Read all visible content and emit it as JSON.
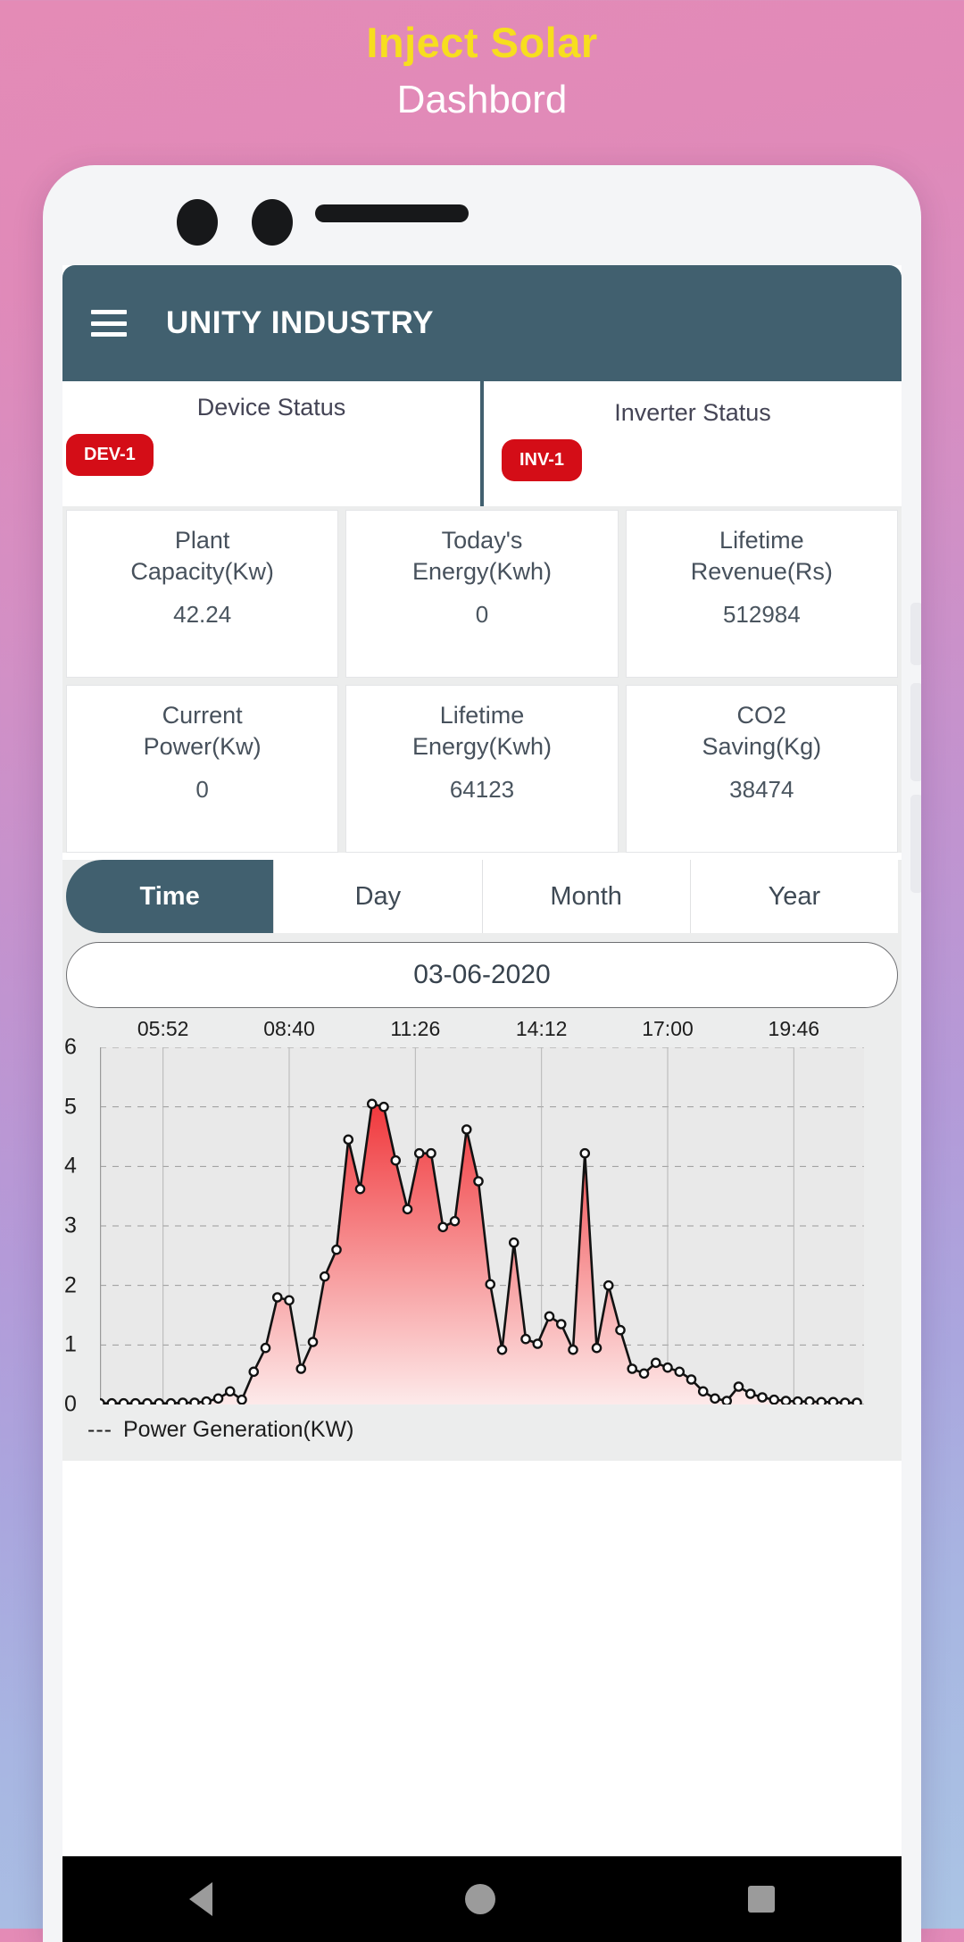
{
  "promo": {
    "title": "Inject Solar",
    "subtitle": "Dashbord",
    "title_color": "#f7de1e",
    "subtitle_color": "#ffffff"
  },
  "appbar": {
    "menu_icon": "hamburger-menu-icon",
    "title": "UNITY INDUSTRY",
    "background": "#41606f"
  },
  "status": {
    "device": {
      "label": "Device Status",
      "badge": "DEV-1",
      "badge_color": "#d40d17"
    },
    "inverter": {
      "label": "Inverter Status",
      "badge": "INV-1",
      "badge_color": "#d40d17"
    }
  },
  "cards": [
    {
      "label": "Plant\nCapacity(Kw)",
      "line1": "Plant",
      "line2": "Capacity(Kw)",
      "value": "42.24"
    },
    {
      "label": "Today's Energy(Kwh)",
      "line1": "Today's",
      "line2": "Energy(Kwh)",
      "value": "0"
    },
    {
      "label": "Lifetime Revenue(Rs)",
      "line1": "Lifetime",
      "line2": "Revenue(Rs)",
      "value": "512984"
    },
    {
      "label": "Current Power(Kw)",
      "line1": "Current",
      "line2": "Power(Kw)",
      "value": "0"
    },
    {
      "label": "Lifetime Energy(Kwh)",
      "line1": "Lifetime",
      "line2": "Energy(Kwh)",
      "value": "64123"
    },
    {
      "label": "CO2 Saving(Kg)",
      "line1": "CO2",
      "line2": "Saving(Kg)",
      "value": "38474"
    }
  ],
  "tabs": [
    {
      "label": "Time",
      "active": true
    },
    {
      "label": "Day",
      "active": false
    },
    {
      "label": "Month",
      "active": false
    },
    {
      "label": "Year",
      "active": false
    }
  ],
  "date_picker": {
    "value": "03-06-2020"
  },
  "chart_data": {
    "type": "area",
    "title": "",
    "xlabel": "",
    "ylabel": "",
    "ylim": [
      0,
      6
    ],
    "yticks": [
      0,
      1,
      2,
      3,
      4,
      5,
      6
    ],
    "xticks": [
      "05:52",
      "08:40",
      "11:26",
      "14:12",
      "17:00",
      "19:46"
    ],
    "grid": true,
    "legend": {
      "position": "bottom-left",
      "marker": "- - -",
      "entries": [
        "Power Generation(KW)"
      ]
    },
    "series": [
      {
        "name": "Power Generation(KW)",
        "line_color": "#121212",
        "fill_from": "#f0383c",
        "fill_to": "#fdeaea",
        "marker": "open-circle",
        "values": [
          0.02,
          0.02,
          0.02,
          0.02,
          0.02,
          0.02,
          0.02,
          0.03,
          0.03,
          0.05,
          0.1,
          0.22,
          0.08,
          0.55,
          0.95,
          1.8,
          1.75,
          0.6,
          1.05,
          2.15,
          2.6,
          4.45,
          3.62,
          5.05,
          5.0,
          4.1,
          3.28,
          4.22,
          4.22,
          2.98,
          3.08,
          4.62,
          3.75,
          2.02,
          0.92,
          2.72,
          1.1,
          1.02,
          1.48,
          1.35,
          0.92,
          4.22,
          0.95,
          2.0,
          1.25,
          0.6,
          0.52,
          0.7,
          0.62,
          0.55,
          0.42,
          0.22,
          0.1,
          0.06,
          0.3,
          0.18,
          0.12,
          0.08,
          0.06,
          0.05,
          0.05,
          0.04,
          0.04,
          0.03,
          0.03
        ]
      }
    ]
  },
  "navbar": {
    "back": "back-triangle-icon",
    "home": "home-circle-icon",
    "recent": "recent-square-icon"
  }
}
